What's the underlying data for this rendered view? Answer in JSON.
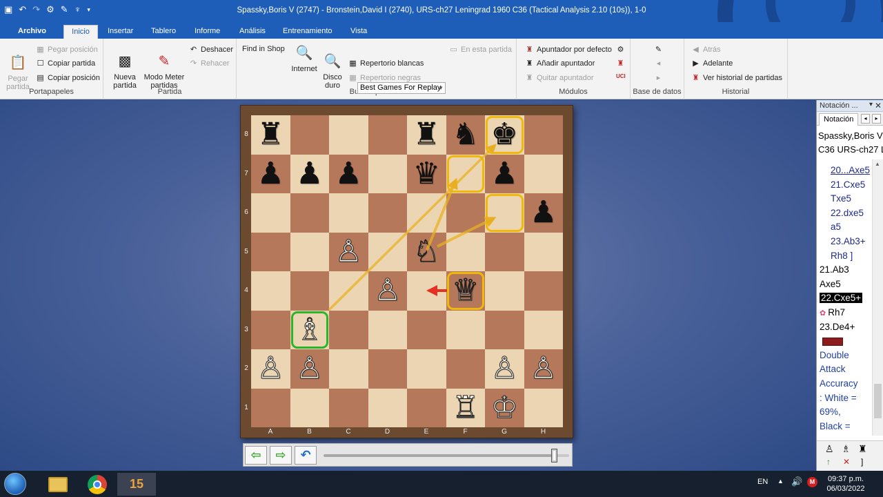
{
  "window": {
    "title": "Spassky,Boris V (2747) - Bronstein,David I (2740), URS-ch27 Leningrad 1960  C36  (Tactical Analysis 2.10 (10s)), 1-0"
  },
  "quick_access": [
    "chessbase-icon",
    "undo-icon",
    "redo-icon",
    "settings-icon",
    "edit-icon",
    "bulb-icon",
    "dropdown-icon"
  ],
  "tabs": [
    "Archivo",
    "Inicio",
    "Insertar",
    "Tablero",
    "Informe",
    "Análisis",
    "Entrenamiento",
    "Vista"
  ],
  "active_tab": "Inicio",
  "ribbon": {
    "portapapeles": {
      "label": "Portapapeles",
      "pegar_partida": "Pegar\npartida",
      "pegar_posicion": "Pegar posición",
      "copiar_partida": "Copiar partida",
      "copiar_posicion": "Copiar posición"
    },
    "partida": {
      "label": "Partida",
      "nueva_partida": "Nueva\npartida",
      "modo_meter": "Modo Meter\npartidas",
      "deshacer": "Deshacer",
      "rehacer": "Rehacer"
    },
    "buscar": {
      "label": "Buscar posición",
      "find_in_shop": "Find in Shop",
      "internet": "Internet",
      "disco_duro": "Disco\nduro",
      "db_selected": "Best Games For Replay",
      "en_esta_partida": "En esta partida",
      "repertorio_blancas": "Repertorio blancas",
      "repertorio_negras": "Repertorio negras"
    },
    "modulos": {
      "label": "Módulos",
      "apuntador_defecto": "Apuntador por defecto",
      "anadir_apuntador": "Añadir apuntador",
      "quitar_apuntador": "Quitar apuntador"
    },
    "base_datos": {
      "label": "Base de datos"
    },
    "historial": {
      "label": "Historial",
      "atras": "Atrás",
      "adelante": "Adelante",
      "ver_historial": "Ver historial de partidas"
    }
  },
  "board": {
    "ranks": [
      "8",
      "7",
      "6",
      "5",
      "4",
      "3",
      "2",
      "1"
    ],
    "files": [
      "A",
      "B",
      "C",
      "D",
      "E",
      "F",
      "G",
      "H"
    ],
    "rows": [
      [
        "♜",
        "",
        "",
        "",
        "♜",
        "♞",
        "♚",
        ""
      ],
      [
        "♟",
        "♟",
        "♟",
        "",
        "♛",
        "",
        "♟",
        ""
      ],
      [
        "",
        "",
        "",
        "",
        "",
        "",
        "",
        "♟"
      ],
      [
        "",
        "",
        "♙",
        "",
        "♘",
        "",
        "",
        ""
      ],
      [
        "",
        "",
        "",
        "♙",
        "",
        "♕",
        "",
        ""
      ],
      [
        "",
        "♗",
        "",
        "",
        "",
        "",
        "",
        ""
      ],
      [
        "♙",
        "♙",
        "",
        "",
        "",
        "",
        "♙",
        "♙"
      ],
      [
        "",
        "",
        "",
        "",
        "",
        "♖",
        "♔",
        ""
      ]
    ],
    "yellow_highlights": [
      "f7",
      "g8",
      "g6",
      "f4"
    ],
    "green_highlights": [
      "b3"
    ],
    "arrow_color_yellow": "#e8b020",
    "arrow_color_red": "#e53024"
  },
  "navigation": {
    "back_icon": "arrow-left-icon",
    "forward_icon": "arrow-right-icon",
    "undo_icon": "return-icon",
    "slider_value": 0.94
  },
  "notation": {
    "header": "Notación ...",
    "tab": "Notación",
    "game_line1": "Spassky,Boris V",
    "game_line2": "C36 URS-ch27 L",
    "moves": [
      {
        "text": "20...Axe5",
        "style": "ind und"
      },
      {
        "text": "21.Cxe5",
        "style": "ind"
      },
      {
        "text": "Txe5",
        "style": "ind"
      },
      {
        "text": "22.dxe5",
        "style": "ind"
      },
      {
        "text": "a5",
        "style": "ind"
      },
      {
        "text": "23.Ab3+",
        "style": "ind"
      },
      {
        "text": "Rh8 ]",
        "style": "ind"
      },
      {
        "text": "21.Ab3",
        "style": "main"
      },
      {
        "text": "Axe5",
        "style": "main"
      },
      {
        "text": "22.Cxe5+",
        "style": "main cur"
      },
      {
        "text": "Rh7",
        "style": "main engine"
      },
      {
        "text": "23.De4+",
        "style": "main"
      },
      {
        "text": "",
        "style": "evalbar"
      },
      {
        "text": "Double",
        "style": "cm"
      },
      {
        "text": "Attack",
        "style": "cm"
      },
      {
        "text": "Accuracy",
        "style": "cm"
      },
      {
        "text": ": White =",
        "style": "cm"
      },
      {
        "text": "69%,",
        "style": "cm"
      },
      {
        "text": "Black =",
        "style": "cm"
      }
    ],
    "eval_color": "#8c1b1b"
  },
  "taskbar": {
    "apps": [
      "start-icon",
      "file-explorer-icon",
      "chrome-icon",
      "chessbase-15-icon"
    ],
    "chessbase_label": "15",
    "language": "EN",
    "time": "09:37 p.m.",
    "date": "06/03/2022"
  }
}
